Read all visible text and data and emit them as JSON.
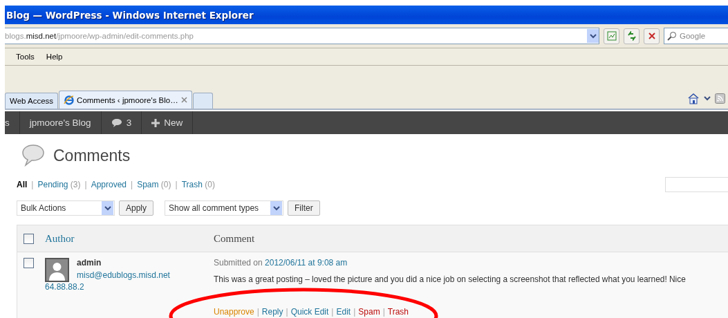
{
  "window": {
    "title": "Blog — WordPress - Windows Internet Explorer"
  },
  "address": {
    "prefix": "blogs.",
    "domain": "misd.net",
    "path": "/jpmoore/wp-admin/edit-comments.php"
  },
  "search": {
    "placeholder": "Google"
  },
  "menu": [
    "Tools",
    "Help"
  ],
  "tabs": [
    {
      "label": "Web Access",
      "selected": false
    },
    {
      "label": "Comments ‹ jpmoore's Blo…",
      "selected": true
    }
  ],
  "admin_bar": {
    "items": [
      {
        "kind": "text",
        "label": "s"
      },
      {
        "kind": "text",
        "label": "jpmoore's Blog"
      },
      {
        "kind": "comments",
        "label": "3"
      },
      {
        "kind": "new",
        "label": "New"
      }
    ]
  },
  "page": {
    "title": "Comments"
  },
  "filters": [
    {
      "label": "All",
      "selected": true
    },
    {
      "separator": "|",
      "label": "Pending",
      "count": "(3)",
      "selected": false
    },
    {
      "separator": "|",
      "label": "Approved",
      "selected": false
    },
    {
      "separator": "|",
      "label": "Spam",
      "count": "(0)",
      "selected": false
    },
    {
      "separator": "|",
      "label": "Trash",
      "count": "(0)",
      "selected": false
    }
  ],
  "bulk": {
    "select": "Bulk Actions",
    "button": "Apply"
  },
  "type_filter": {
    "select": "Show all comment types",
    "button": "Filter"
  },
  "table": {
    "columns": [
      "Author",
      "Comment"
    ],
    "select_all_checked": false,
    "rows": [
      {
        "checked": false,
        "author": "admin",
        "email": "misd@edublogs.misd.net",
        "ip": "64.88.88.2",
        "submitted_prefix": "Submitted on",
        "submitted_date": "2012/06/11 at 9:08 am",
        "text": "This was a great posting – loved the picture and you did a nice job on selecting a screenshot that reflected what you learned! Nice",
        "actions": [
          {
            "label": "Unapprove",
            "color": "#d98500"
          },
          {
            "separator": "|",
            "label": "Reply",
            "color": "#21759b"
          },
          {
            "separator": "|",
            "label": "Quick Edit",
            "color": "#21759b"
          },
          {
            "separator": "|",
            "label": "Edit",
            "color": "#21759b"
          },
          {
            "separator": "|",
            "label": "Spam",
            "color": "#bc0b0b"
          },
          {
            "separator": "|",
            "label": "Trash",
            "color": "#bc0b0b"
          }
        ]
      }
    ]
  }
}
